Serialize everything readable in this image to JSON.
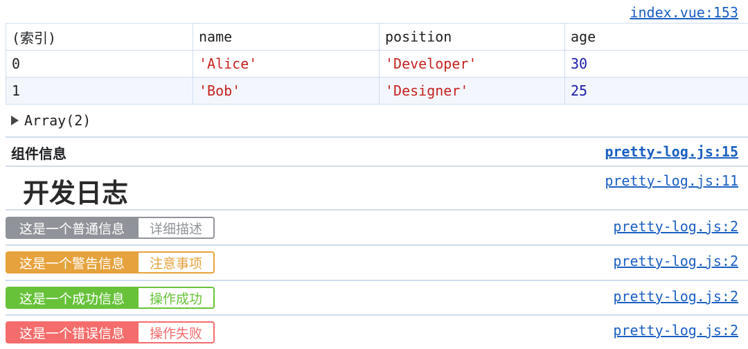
{
  "colors": {
    "link": "#1a5fc1",
    "string": "#c5221f",
    "number": "#1a1aa6",
    "info": "#909399",
    "warning": "#e6a23c",
    "success": "#67c23a",
    "error": "#f56c6c"
  },
  "top_source": "index.vue:153",
  "table": {
    "headers": [
      "(索引)",
      "name",
      "position",
      "age"
    ],
    "rows": [
      [
        "0",
        "'Alice'",
        "'Developer'",
        "30"
      ],
      [
        "1",
        "'Bob'",
        "'Designer'",
        "25"
      ]
    ]
  },
  "array_summary": "Array(2)",
  "group": {
    "title": "组件信息",
    "source": "pretty-log.js:15"
  },
  "heading": {
    "text": "开发日志",
    "source": "pretty-log.js:11"
  },
  "badges": [
    {
      "label": "这是一个普通信息",
      "detail": "详细描述",
      "color": "#909399",
      "source": "pretty-log.js:2"
    },
    {
      "label": "这是一个警告信息",
      "detail": "注意事项",
      "color": "#e6a23c",
      "source": "pretty-log.js:2"
    },
    {
      "label": "这是一个成功信息",
      "detail": "操作成功",
      "color": "#67c23a",
      "source": "pretty-log.js:2"
    },
    {
      "label": "这是一个错误信息",
      "detail": "操作失败",
      "color": "#f56c6c",
      "source": "pretty-log.js:2"
    }
  ]
}
